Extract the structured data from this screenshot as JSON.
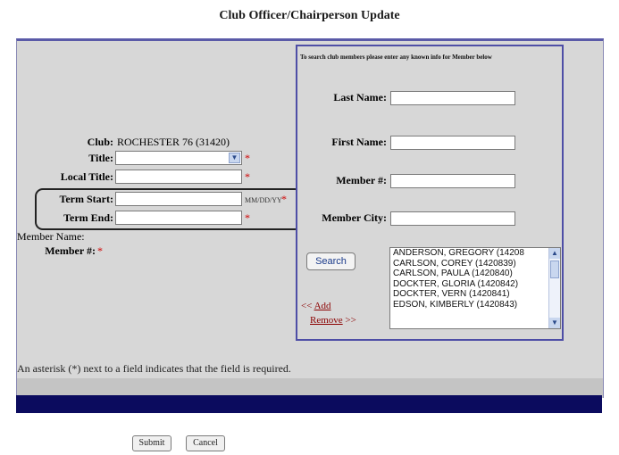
{
  "page": {
    "title": "Club Officer/Chairperson Update"
  },
  "left": {
    "club_label": "Club:",
    "club_value": "ROCHESTER 76 (31420)",
    "title_label": "Title:",
    "local_title_label": "Local Title:",
    "term_start_label": "Term Start:",
    "term_start_hint": "MM/DD/YY",
    "term_end_label": "Term End:",
    "member_name_label": "Member Name:",
    "member_num_label": "Member #:",
    "required_mark": "*"
  },
  "search": {
    "instruction": "To search club members please enter any known info for Member below",
    "last_name_label": "Last Name:",
    "first_name_label": "First Name:",
    "member_num_label": "Member #:",
    "member_city_label": "Member City:",
    "search_button": "Search",
    "add_prefix": "<<",
    "add_link": "Add",
    "remove_link": "Remove",
    "remove_suffix": ">>",
    "results": [
      "ANDERSON, GREGORY (14208",
      "CARLSON, COREY (1420839)",
      "CARLSON, PAULA (1420840)",
      "DOCKTER, GLORIA (1420842)",
      "DOCKTER, VERN (1420841)",
      "EDSON, KIMBERLY (1420843)"
    ]
  },
  "note": "An asterisk (*) next to a field indicates that the field is required.",
  "footer": {
    "submit": "Submit",
    "cancel": "Cancel"
  }
}
